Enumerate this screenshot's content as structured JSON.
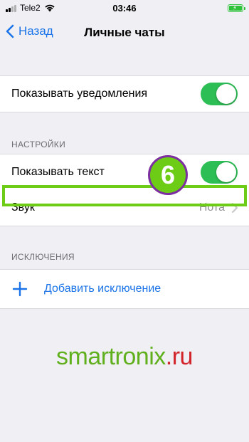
{
  "status_bar": {
    "carrier": "Tele2",
    "time": "03:46",
    "icons": [
      "signal-icon",
      "wifi-icon",
      "battery-charging-icon"
    ]
  },
  "nav": {
    "back_label": "Назад",
    "title": "Личные чаты"
  },
  "notifications_row": {
    "label": "Показывать уведомления",
    "toggle_on": true
  },
  "settings_section": {
    "header": "НАСТРОЙКИ",
    "show_text_label": "Показывать текст",
    "show_text_on": true,
    "sound_label": "Звук",
    "sound_value": "Нота"
  },
  "exceptions_section": {
    "header": "ИСКЛЮЧЕНИЯ",
    "add_label": "Добавить исключение"
  },
  "annotation": {
    "step_number": "6",
    "highlight_color": "#6dcc16",
    "badge_border_color": "#7b2fa0"
  },
  "watermark": {
    "part1": "smartronix",
    "part2": ".ru"
  },
  "colors": {
    "accent": "#1a73e8",
    "toggle_on": "#2dbe55",
    "background": "#efeff4"
  }
}
